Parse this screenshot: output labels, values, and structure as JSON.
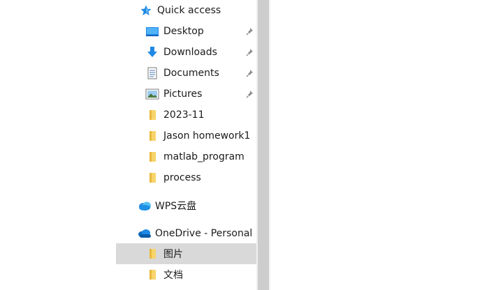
{
  "nav": {
    "quick_access": {
      "label": "Quick access",
      "icon": "star-icon"
    },
    "items": [
      {
        "label": "Desktop",
        "icon": "desktop-icon",
        "pinned": true
      },
      {
        "label": "Downloads",
        "icon": "download-arrow-icon",
        "pinned": true
      },
      {
        "label": "Documents",
        "icon": "document-icon",
        "pinned": true
      },
      {
        "label": "Pictures",
        "icon": "picture-icon",
        "pinned": true
      },
      {
        "label": "2023-11",
        "icon": "folder-icon",
        "pinned": false
      },
      {
        "label": "Jason homework1",
        "icon": "folder-icon",
        "pinned": false
      },
      {
        "label": "matlab_program",
        "icon": "folder-icon",
        "pinned": false
      },
      {
        "label": "process",
        "icon": "folder-icon",
        "pinned": false
      }
    ],
    "wps": {
      "label": "WPS云盘",
      "icon": "cloud-icon"
    },
    "onedrive": {
      "label": "OneDrive - Personal",
      "icon": "onedrive-cloud-icon"
    },
    "onedrive_items": [
      {
        "label": "图片",
        "icon": "folder-icon",
        "selected": true
      },
      {
        "label": "文档",
        "icon": "folder-icon",
        "selected": false
      }
    ]
  },
  "colors": {
    "selected_bg": "#d9d9d9",
    "scrollbar_thumb": "#cdcdcd",
    "accent_blue": "#0a6ed1",
    "folder_yellow": "#f7d46b"
  }
}
